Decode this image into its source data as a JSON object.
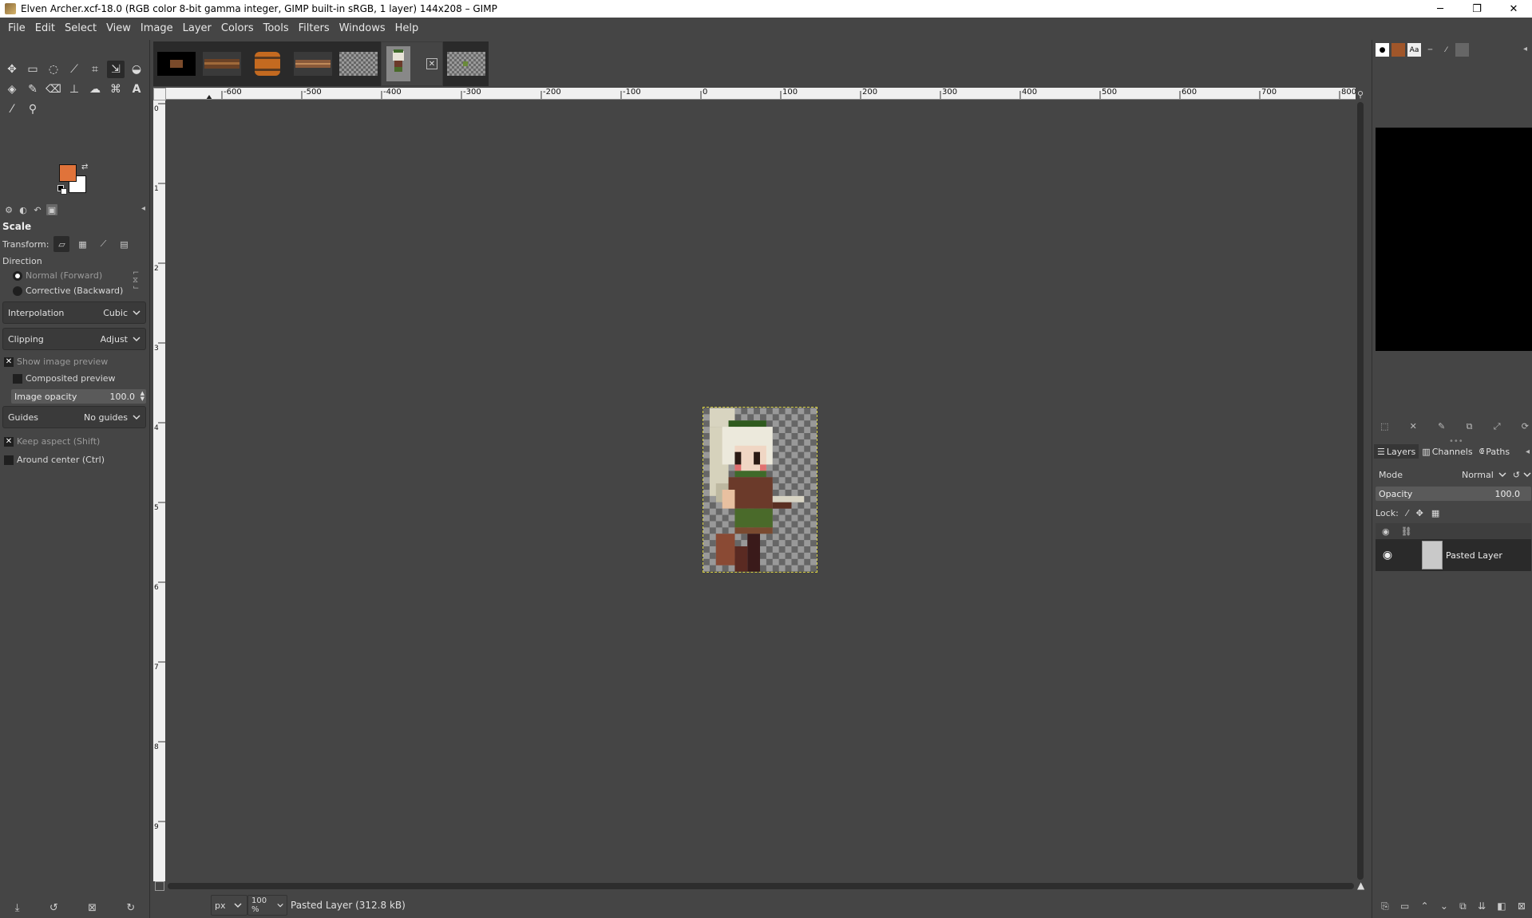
{
  "window": {
    "title": "Elven Archer.xcf-18.0 (RGB color 8-bit gamma integer, GIMP built-in sRGB, 1 layer) 144x208 – GIMP",
    "minimize": "─",
    "maximize": "❐",
    "close": "✕"
  },
  "menu": [
    "File",
    "Edit",
    "Select",
    "View",
    "Image",
    "Layer",
    "Colors",
    "Tools",
    "Filters",
    "Windows",
    "Help"
  ],
  "colors": {
    "foreground": "#e0733a",
    "background": "#ffffff"
  },
  "tool_options": {
    "title": "Scale",
    "transform_label": "Transform:",
    "direction_label": "Direction",
    "direction_forward": "Normal (Forward)",
    "direction_backward": "Corrective (Backward)",
    "interpolation_label": "Interpolation",
    "interpolation_value": "Cubic",
    "clipping_label": "Clipping",
    "clipping_value": "Adjust",
    "show_preview": "Show image preview",
    "composited_preview": "Composited preview",
    "image_opacity_label": "Image opacity",
    "image_opacity_value": "100.0",
    "guides_label": "Guides",
    "guides_value": "No guides",
    "keep_aspect": "Keep aspect (Shift)",
    "around_center": "Around center (Ctrl)"
  },
  "ruler": {
    "h_labels": [
      "-600",
      "-500",
      "-400",
      "-300",
      "-200",
      "-100",
      "0",
      "100",
      "200",
      "300",
      "400",
      "500",
      "600",
      "700",
      "800"
    ],
    "v_labels": [
      "0",
      "1",
      "2",
      "3",
      "4",
      "5",
      "6",
      "7",
      "8",
      "9",
      "10"
    ]
  },
  "status": {
    "unit": "px",
    "zoom": "100 %",
    "message": "Pasted Layer (312.8 kB)"
  },
  "layers_panel": {
    "tabs": [
      "Layers",
      "Channels",
      "Paths"
    ],
    "mode_label": "Mode",
    "mode_value": "Normal",
    "opacity_label": "Opacity",
    "opacity_value": "100.0",
    "lock_label": "Lock:",
    "layer_name": "Pasted Layer"
  }
}
